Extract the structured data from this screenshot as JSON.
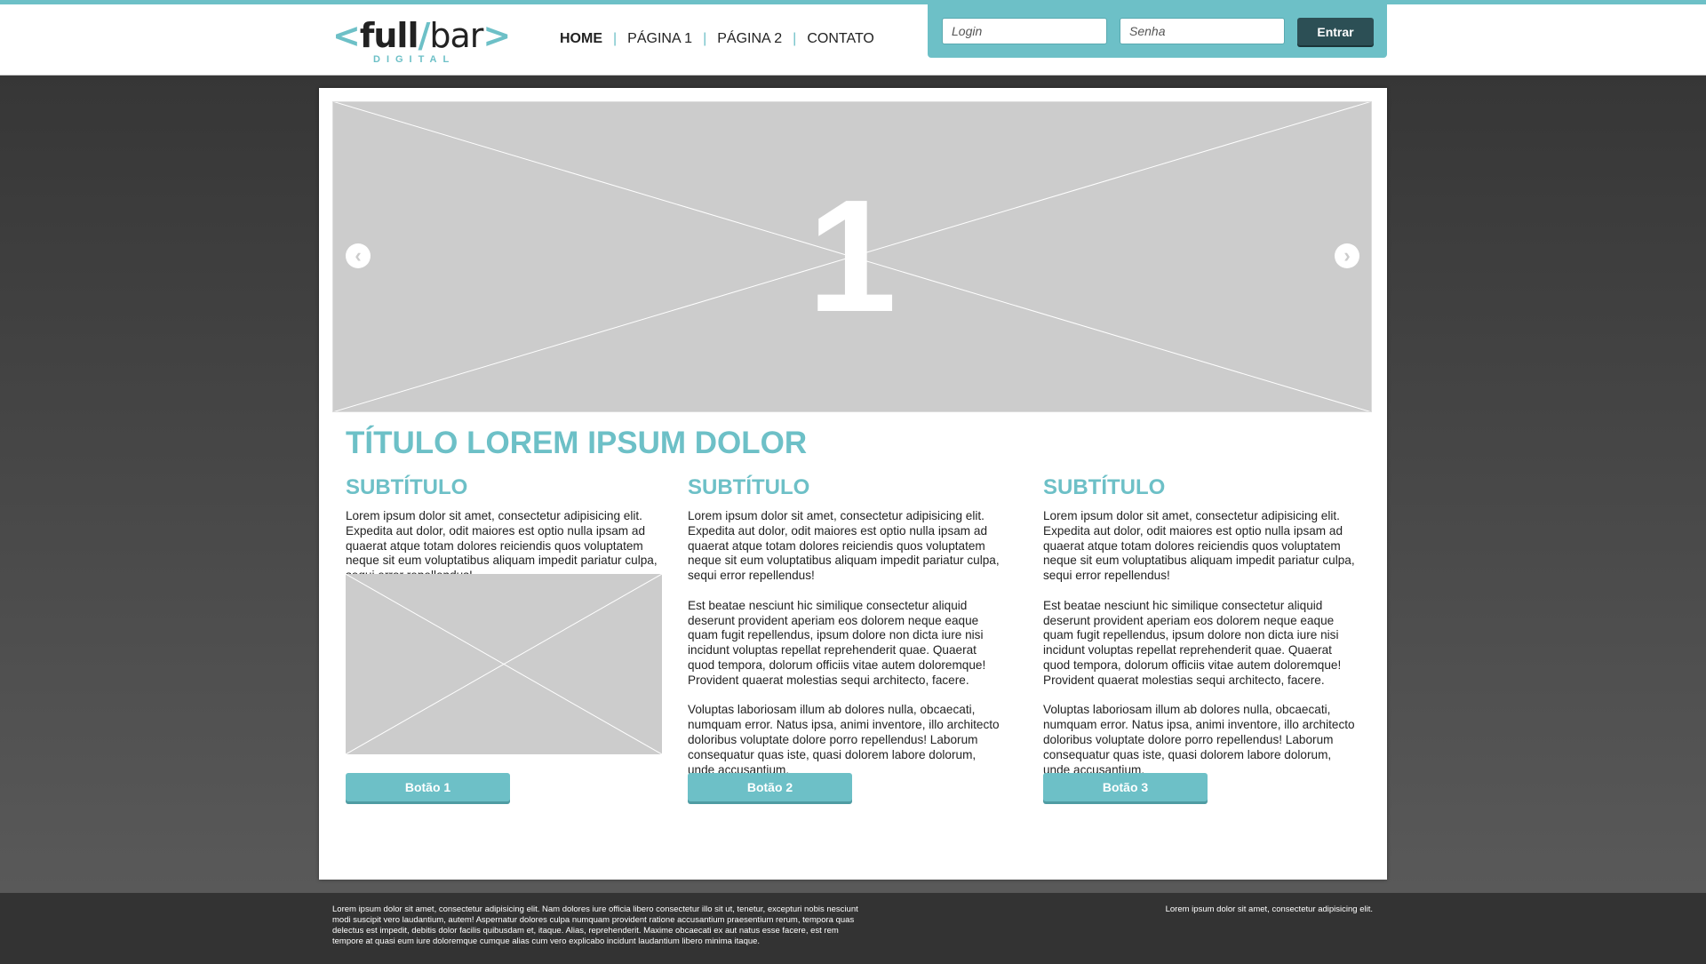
{
  "logo": {
    "left_bracket": "<",
    "word1": "full",
    "slash": "/",
    "word2": "bar",
    "right_bracket": ">",
    "tagline": "DIGITAL"
  },
  "nav": {
    "items": [
      {
        "label": "HOME",
        "active": true
      },
      {
        "label": "PÁGINA 1",
        "active": false
      },
      {
        "label": "PÁGINA 2",
        "active": false
      },
      {
        "label": "CONTATO",
        "active": false
      }
    ],
    "separator": "|"
  },
  "login": {
    "login_placeholder": "Login",
    "login_value": "",
    "senha_placeholder": "Senha",
    "senha_value": "",
    "submit_label": "Entrar"
  },
  "slider": {
    "slide_number": "1",
    "prev_icon": "chevron-left-icon",
    "next_icon": "chevron-right-icon"
  },
  "main": {
    "title": "TÍTULO LOREM IPSUM DOLOR",
    "columns": [
      {
        "subtitle": "SUBTÍTULO",
        "paragraphs": [
          "Lorem ipsum dolor sit amet, consectetur adipisicing elit. Expedita aut dolor, odit maiores est optio nulla ipsam ad quaerat atque totam dolores reiciendis quos voluptatem neque sit eum voluptatibus aliquam impedit pariatur culpa, sequi error repellendus!"
        ],
        "button": "Botão 1"
      },
      {
        "subtitle": "SUBTÍTULO",
        "paragraphs": [
          "Lorem ipsum dolor sit amet, consectetur adipisicing elit. Expedita aut dolor, odit maiores est optio nulla ipsam ad quaerat atque totam dolores reiciendis quos voluptatem neque sit eum voluptatibus aliquam impedit pariatur culpa, sequi error repellendus!",
          "Est beatae nesciunt hic similique consectetur aliquid deserunt provident aperiam eos dolorem neque eaque quam fugit repellendus, ipsum dolore non dicta iure nisi incidunt voluptas repellat reprehenderit quae. Quaerat quod tempora, dolorum officiis vitae autem doloremque! Provident quaerat molestias sequi architecto, facere.",
          "Voluptas laboriosam illum ab dolores nulla, obcaecati, numquam error. Natus ipsa, animi inventore, illo architecto doloribus voluptate dolore porro repellendus! Laborum consequatur quas iste, quasi dolorem labore dolorum, unde accusantium."
        ],
        "button": "Botão 2"
      },
      {
        "subtitle": "SUBTÍTULO",
        "paragraphs": [
          "Lorem ipsum dolor sit amet, consectetur adipisicing elit. Expedita aut dolor, odit maiores est optio nulla ipsam ad quaerat atque totam dolores reiciendis quos voluptatem neque sit eum voluptatibus aliquam impedit pariatur culpa, sequi error repellendus!",
          "Est beatae nesciunt hic similique consectetur aliquid deserunt provident aperiam eos dolorem neque eaque quam fugit repellendus, ipsum dolore non dicta iure nisi incidunt voluptas repellat reprehenderit quae. Quaerat quod tempora, dolorum officiis vitae autem doloremque! Provident quaerat molestias sequi architecto, facere.",
          "Voluptas laboriosam illum ab dolores nulla, obcaecati, numquam error. Natus ipsa, animi inventore, illo architecto doloribus voluptate dolore porro repellendus! Laborum consequatur quas iste, quasi dolorem labore dolorum, unde accusantium."
        ],
        "button": "Botão 3"
      }
    ]
  },
  "footer": {
    "left_text": "Lorem ipsum dolor sit amet, consectetur adipisicing elit. Nam dolores iure officia libero consectetur illo sit ut, tenetur, excepturi nobis nesciunt modi suscipit vero laudantium, autem! Aspernatur dolores culpa numquam provident ratione accusantium praesentium rerum, tempora quas delectus est impedit, debitis dolor facilis quibusdam et, itaque. Alias, reprehenderit. Maxime obcaecati ex aut natus esse facere, est rem tempore at quasi eum iure doloremque cumque alias cum vero explicabo incidunt laudantium libero minima itaque.",
    "right_text": "Lorem ipsum dolor sit amet, consectetur adipisicing elit."
  },
  "colors": {
    "accent": "#6dc0c7",
    "dark_button": "#2c4f55",
    "placeholder_gray": "#cccccc",
    "footer_bg": "#333333"
  }
}
